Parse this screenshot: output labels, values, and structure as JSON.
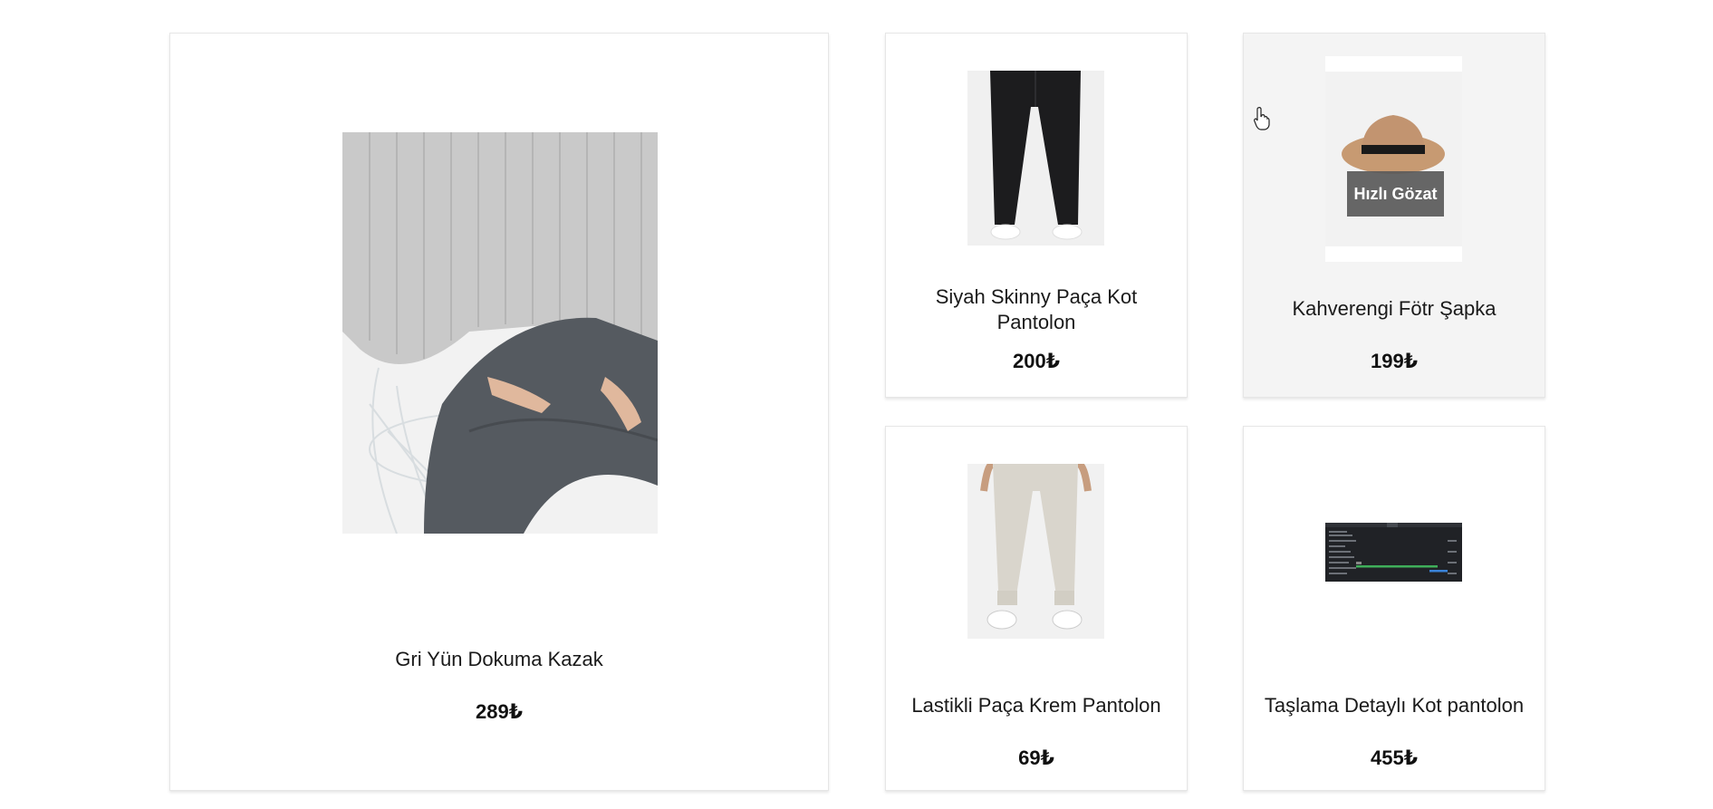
{
  "products": [
    {
      "name": "Gri Yün Dokuma Kazak",
      "price": "289₺"
    },
    {
      "name": "Siyah Skinny Paça Kot Pantolon",
      "price": "200₺"
    },
    {
      "name": "Kahverengi Fötr Şapka",
      "price": "199₺",
      "quick_view": "Hızlı Gözat"
    },
    {
      "name": "Lastikli Paça Krem Pantolon",
      "price": "69₺"
    },
    {
      "name": "Taşlama Detaylı Kot pantolon",
      "price": "455₺"
    }
  ],
  "icons": {
    "cursor": "hand-pointer-icon"
  }
}
